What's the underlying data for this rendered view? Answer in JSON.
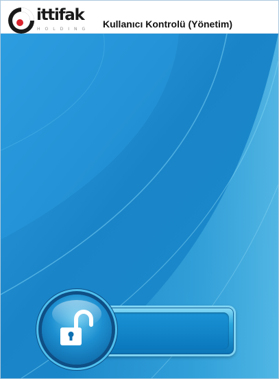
{
  "header": {
    "logo": {
      "word": "ittifak",
      "sub": "HOLDING"
    },
    "title": "Kullanıcı Kontrolü (Yönetim)"
  },
  "login": {
    "password_value": "",
    "unlock_icon": "unlock-icon"
  },
  "colors": {
    "brand_red": "#d9232d",
    "background_blue": "#1e87c6",
    "accent_cyan": "#5fcaf2"
  }
}
